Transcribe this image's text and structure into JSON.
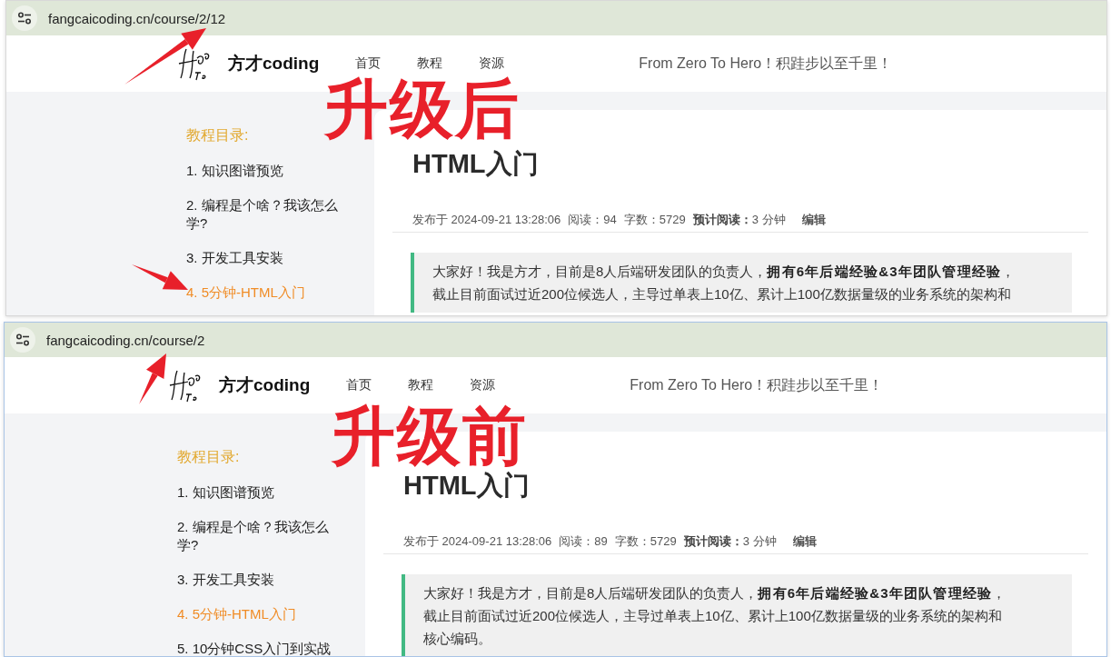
{
  "captures": [
    {
      "address": "fangcaicoding.cn/course/2/12",
      "annotation": "升级后",
      "brand": "方才coding",
      "nav": [
        {
          "label": "首页"
        },
        {
          "label": "教程"
        },
        {
          "label": "资源"
        }
      ],
      "slogan": "From Zero To Hero！积跬步以至千里！",
      "toc_title": "教程目录:",
      "toc": [
        {
          "label": "1. 知识图谱预览",
          "selected": false
        },
        {
          "label": "2. 编程是个啥？我该怎么学?",
          "selected": false
        },
        {
          "label": "3. 开发工具安装",
          "selected": false
        },
        {
          "label": "4. 5分钟-HTML入门",
          "selected": true
        }
      ],
      "article": {
        "title": "HTML入门",
        "meta": [
          {
            "kind": "text",
            "text": "发布于 2024-09-21 13:28:06"
          },
          {
            "kind": "text",
            "text": "阅读：94"
          },
          {
            "kind": "text",
            "text": "字数：5729"
          },
          {
            "kind": "text",
            "text": "**预计阅读：**3 分钟"
          },
          {
            "kind": "link",
            "text": "编辑"
          }
        ],
        "quote": "大家好！我是方才，目前是8人后端研发团队的负责人，**拥有6年后端经验&3年团队管理经验**，截止目前面试过近200位候选人，主导过单表上10亿、累计上100亿数据量级的业务系统的架构和"
      }
    },
    {
      "address": "fangcaicoding.cn/course/2",
      "annotation": "升级前",
      "brand": "方才coding",
      "nav": [
        {
          "label": "首页"
        },
        {
          "label": "教程"
        },
        {
          "label": "资源"
        }
      ],
      "slogan": "From Zero To Hero！积跬步以至千里！",
      "toc_title": "教程目录:",
      "toc": [
        {
          "label": "1. 知识图谱预览",
          "selected": false
        },
        {
          "label": "2. 编程是个啥？我该怎么学?",
          "selected": false
        },
        {
          "label": "3. 开发工具安装",
          "selected": false
        },
        {
          "label": "4. 5分钟-HTML入门",
          "selected": true
        },
        {
          "label": "5. 10分钟CSS入门到实战",
          "selected": false
        }
      ],
      "article": {
        "title": "HTML入门",
        "meta": [
          {
            "kind": "text",
            "text": "发布于 2024-09-21 13:28:06"
          },
          {
            "kind": "text",
            "text": "阅读：89"
          },
          {
            "kind": "text",
            "text": "字数：5729"
          },
          {
            "kind": "text",
            "text": "**预计阅读：**3 分钟"
          },
          {
            "kind": "link",
            "text": "编辑"
          }
        ],
        "quote": "大家好！我是方才，目前是8人后端研发团队的负责人，**拥有6年后端经验&3年团队管理经验**，截止目前面试过近200位候选人，主导过单表上10亿、累计上100亿数据量级的业务系统的架构和核心编码。"
      }
    }
  ]
}
